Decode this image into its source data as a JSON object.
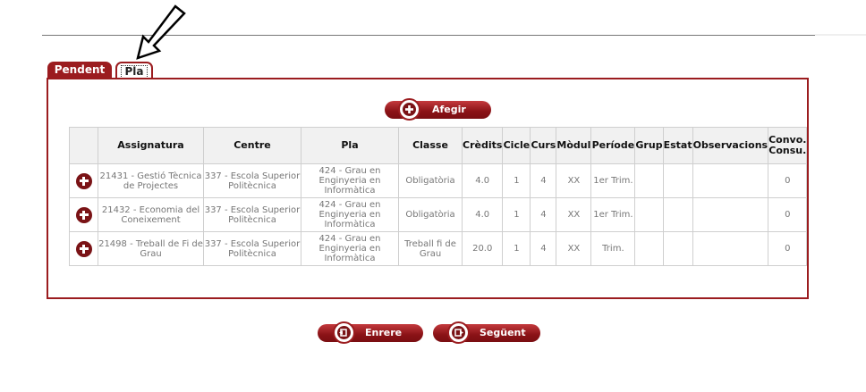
{
  "tabs": [
    {
      "label": "Pendent",
      "active": false
    },
    {
      "label": "Pla",
      "active": true
    }
  ],
  "buttons": {
    "add_label": "Afegir",
    "back_label": "Enrere",
    "next_label": "Següent"
  },
  "table": {
    "columns": [
      "",
      "Assignatura",
      "Centre",
      "Pla",
      "Classe",
      "Crèdits",
      "Cicle",
      "Curs",
      "Mòdul",
      "Període",
      "Grup",
      "Estat",
      "Observacions",
      "Convo.\nConsu."
    ],
    "rows": [
      {
        "assignatura": "21431 - Gestió Tècnica de Projectes",
        "centre": "337 - Escola Superior Politècnica",
        "pla": "424 - Grau en Enginyeria en Informàtica",
        "classe": "Obligatòria",
        "credits": "4.0",
        "cicle": "1",
        "curs": "4",
        "modul": "XX",
        "periode": "1er Trim.",
        "grup": "",
        "estat": "",
        "observacions": "",
        "convo": "0"
      },
      {
        "assignatura": "21432 - Economia del Coneixement",
        "centre": "337 - Escola Superior Politècnica",
        "pla": "424 - Grau en Enginyeria en Informàtica",
        "classe": "Obligatòria",
        "credits": "4.0",
        "cicle": "1",
        "curs": "4",
        "modul": "XX",
        "periode": "1er Trim.",
        "grup": "",
        "estat": "",
        "observacions": "",
        "convo": "0"
      },
      {
        "assignatura": "21498 - Treball de Fi de Grau",
        "centre": "337 - Escola Superior Politècnica",
        "pla": "424 - Grau en Enginyeria en Informàtica",
        "classe": "Treball fi de Grau",
        "credits": "20.0",
        "cicle": "1",
        "curs": "4",
        "modul": "XX",
        "periode": "Trim.",
        "grup": "",
        "estat": "",
        "observacions": "",
        "convo": "0"
      }
    ]
  },
  "colors": {
    "brand": "#9b1c1f",
    "border": "#cfcfcf"
  },
  "icons": {
    "pointer": "arrow-pointer-icon",
    "add": "plus-circle-icon",
    "back": "back-icon",
    "next": "next-icon"
  }
}
